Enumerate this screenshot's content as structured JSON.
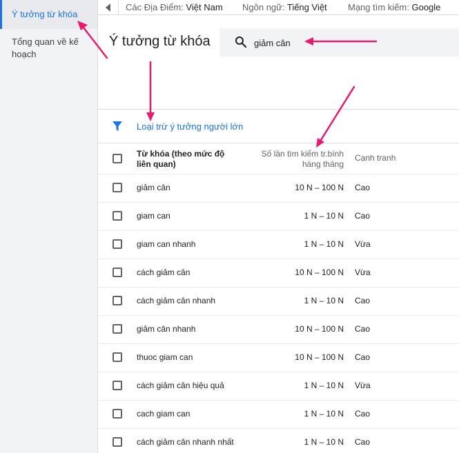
{
  "sidebar": {
    "items": [
      {
        "label": "Ý tưởng từ khóa"
      },
      {
        "label": "Tổng quan về kế hoạch"
      }
    ]
  },
  "topbar": {
    "location_key": "Các Địa Điểm:",
    "location_value": "Việt Nam",
    "language_key": "Ngôn ngữ:",
    "language_value": "Tiếng Việt",
    "network_key": "Mạng tìm kiếm:",
    "network_value": "Google"
  },
  "page": {
    "title": "Ý tưởng từ khóa"
  },
  "search": {
    "value": "giảm cân"
  },
  "filter": {
    "label": "Loại trừ ý tưởng người lớn"
  },
  "table": {
    "headers": {
      "keyword": "Từ khóa (theo mức độ liên quan)",
      "volume": "Số lần tìm kiếm tr.bình hàng tháng",
      "competition": "Cạnh tranh"
    },
    "rows": [
      {
        "keyword": "giảm cân",
        "volume": "10 N – 100 N",
        "competition": "Cao"
      },
      {
        "keyword": "giam can",
        "volume": "1 N – 10 N",
        "competition": "Cao"
      },
      {
        "keyword": "giam can nhanh",
        "volume": "1 N – 10 N",
        "competition": "Vừa"
      },
      {
        "keyword": "cách giảm cân",
        "volume": "10 N – 100 N",
        "competition": "Vừa"
      },
      {
        "keyword": "cách giảm cân nhanh",
        "volume": "1 N – 10 N",
        "competition": "Cao"
      },
      {
        "keyword": "giảm cân nhanh",
        "volume": "10 N – 100 N",
        "competition": "Cao"
      },
      {
        "keyword": "thuoc giam can",
        "volume": "10 N – 100 N",
        "competition": "Cao"
      },
      {
        "keyword": "cách giảm cân hiệu quả",
        "volume": "1 N – 10 N",
        "competition": "Vừa"
      },
      {
        "keyword": "cach giam can",
        "volume": "1 N – 10 N",
        "competition": "Cao"
      },
      {
        "keyword": "cách giảm cân nhanh nhất",
        "volume": "1 N – 10 N",
        "competition": "Cao"
      }
    ]
  },
  "colors": {
    "accent": "#1a73e8",
    "annotation_arrow": "#e8196e"
  }
}
